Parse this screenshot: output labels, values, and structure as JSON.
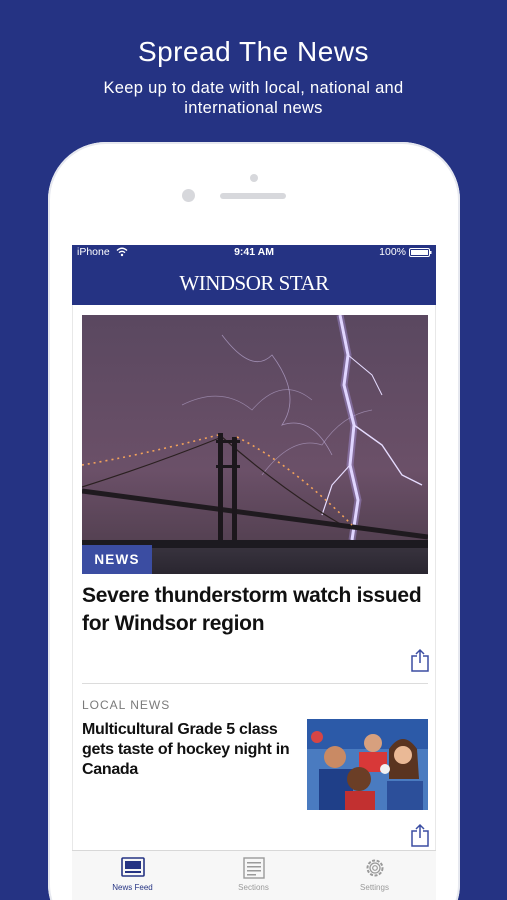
{
  "promo": {
    "title": "Spread The News",
    "subtitle": "Keep up to date with local, national and international news"
  },
  "status_bar": {
    "carrier": "iPhone",
    "time": "9:41 AM",
    "battery": "100%"
  },
  "app": {
    "logo": "WINDSOR STAR"
  },
  "feed": {
    "lead_story": {
      "section_badge": "NEWS",
      "headline": "Severe thunderstorm watch issued for Windsor region"
    },
    "second_story": {
      "section_label": "LOCAL NEWS",
      "headline": "Multicultural Grade 5 class gets taste of hockey night in Canada"
    }
  },
  "tab_bar": {
    "tabs": [
      {
        "label": "News Feed",
        "icon": "news-feed-icon",
        "active": true
      },
      {
        "label": "Sections",
        "icon": "sections-icon",
        "active": false
      },
      {
        "label": "Settings",
        "icon": "gear-icon",
        "active": false
      }
    ]
  },
  "colors": {
    "brand_navy": "#253383",
    "badge_blue": "#3b4da2",
    "tab_inactive": "#9a9a9a"
  }
}
